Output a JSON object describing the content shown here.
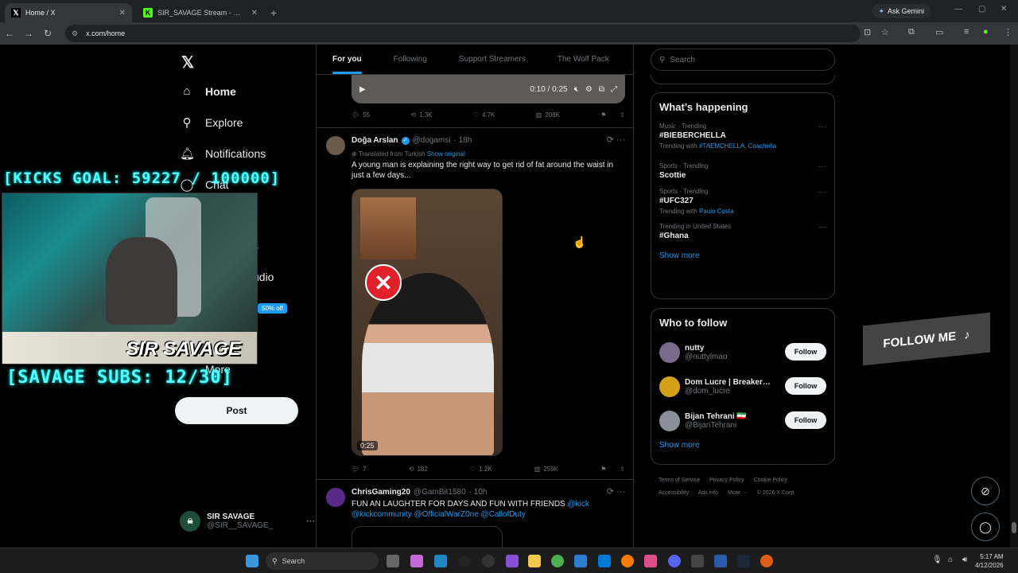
{
  "browser": {
    "tabs": [
      {
        "title": "Home / X",
        "active": true
      },
      {
        "title": "SIR_SAVAGE Stream - Watch Liv",
        "active": false
      }
    ],
    "new_tab_symbol": "+",
    "ask_gemini": "Ask Gemini",
    "url": "x.com/home"
  },
  "nav": {
    "items": [
      {
        "label": "Home",
        "icon": "home-icon"
      },
      {
        "label": "Explore",
        "icon": "search-icon"
      },
      {
        "label": "Notifications",
        "icon": "bell-icon"
      },
      {
        "label": "Chat",
        "icon": "chat-icon"
      },
      {
        "label": "s",
        "icon": "bookmark-icon"
      },
      {
        "label": "udio",
        "icon": "studio-icon"
      },
      {
        "label": "More",
        "icon": "more-icon"
      }
    ],
    "post_label": "Post",
    "profile": {
      "name": "SIR SAVAGE",
      "handle": "@SIR__SAVAGE_",
      "more": "···"
    }
  },
  "overlay": {
    "kicks_goal": "[KICKS GOAL: 59227 / 100000]",
    "subs": "[SAVAGE SUBS: 12/30]",
    "streamer_name": "SIR SAVAGE",
    "discount": "50% off",
    "follow_me": "FOLLOW ME"
  },
  "feed": {
    "tabs": [
      "For you",
      "Following",
      "Support Streamers",
      "The Wolf Pack"
    ],
    "video1": {
      "time": "0:10 / 0:25"
    },
    "tweet0_stats": {
      "replies": "55",
      "reposts": "1.3K",
      "likes": "4.7K",
      "views": "208K"
    },
    "tweet1": {
      "name": "Doğa Arslan",
      "handle": "@dogamsi",
      "time": "· 18h",
      "translated": "Translated from Turkish",
      "show_original": "Show original",
      "text": "A young man is explaining the right way to get rid of fat around the waist in just a few days...",
      "duration": "0:25",
      "stats": {
        "replies": "7",
        "reposts": "182",
        "likes": "1.2K",
        "views": "259K"
      }
    },
    "tweet2": {
      "name": "ChrisGaming20",
      "handle": "@GamBit1580",
      "time": "· 10h",
      "text": "FUN AN LAUGHTER FOR DAYS AND FUN WITH FRIENDS",
      "mentions1": "@kick",
      "mentions2": "@kickcommunity @OfficialWarZ0ne @CallofDuty"
    }
  },
  "sidebar": {
    "search_placeholder": "Search",
    "happening_title": "What’s happening",
    "trends": [
      {
        "context": "Music · Trending",
        "title": "#BIEBERCHELLA",
        "with": "Trending with ",
        "with_links": "#TAEMCHELLA, Coachella"
      },
      {
        "context": "Sports · Trending",
        "title": "Scottie",
        "with": "",
        "with_links": ""
      },
      {
        "context": "Sports · Trending",
        "title": "#UFC327",
        "with": "Trending with ",
        "with_links": "Paulo Costa"
      },
      {
        "context": "Trending in United States",
        "title": "#Ghana",
        "with": "",
        "with_links": ""
      }
    ],
    "show_more": "Show more",
    "who_to_follow_title": "Who to follow",
    "follow_suggestions": [
      {
        "name": "nutty",
        "handle": "@nuttylmao",
        "color": "#7a6a8a"
      },
      {
        "name": "Dom Lucre | Breaker…",
        "handle": "@dom_lucre",
        "color": "#d4a017"
      },
      {
        "name": "Bijan Tehrani 🇮🇷",
        "handle": "@BijanTehrani",
        "color": "#8a8f99"
      }
    ],
    "follow_label": "Follow",
    "show_more_2": "Show more",
    "footer": [
      "Terms of Service",
      "Privacy Policy",
      "Cookie Policy",
      "Accessibility",
      "Ads info",
      "More ···",
      "© 2026 X Corp."
    ]
  },
  "taskbar": {
    "search": "Search",
    "time": "5:17 AM",
    "date": "4/12/2026"
  }
}
